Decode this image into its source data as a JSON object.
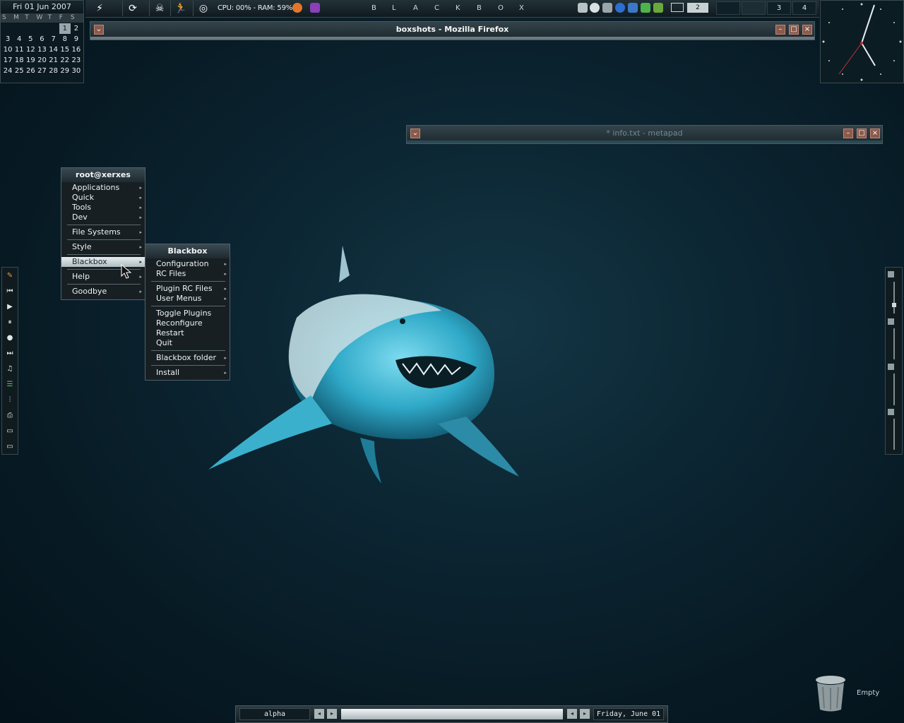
{
  "calendar": {
    "date": "Fri 01 Jun 2007",
    "dow": [
      "S",
      "M",
      "T",
      "W",
      "T",
      "F",
      "S"
    ],
    "weeks": [
      [
        "",
        "",
        "",
        "",
        "",
        "1",
        "2"
      ],
      [
        "3",
        "4",
        "5",
        "6",
        "7",
        "8",
        "9"
      ],
      [
        "10",
        "11",
        "12",
        "13",
        "14",
        "15",
        "16"
      ],
      [
        "17",
        "18",
        "19",
        "20",
        "21",
        "22",
        "23"
      ],
      [
        "24",
        "25",
        "26",
        "27",
        "28",
        "29",
        "30"
      ]
    ]
  },
  "topbar": {
    "cpu_ram": "CPU: 00% - RAM: 59%",
    "workspace_letters": [
      "B",
      "L",
      "A",
      "C",
      "K",
      "B",
      "O",
      "X"
    ],
    "mail_count": "2",
    "pager": [
      "",
      "",
      "3",
      "4"
    ]
  },
  "firefox_window": {
    "title": "boxshots - Mozilla Firefox"
  },
  "metapad_window": {
    "title": "* info.txt - metapad"
  },
  "root_menu": {
    "title": "root@xerxes",
    "items": [
      "Applications",
      "Quick",
      "Tools",
      "Dev",
      "File Systems",
      "Style",
      "Blackbox",
      "Help",
      "Goodbye"
    ]
  },
  "blackbox_menu": {
    "title": "Blackbox",
    "items": [
      "Configuration",
      "RC Files",
      "Plugin RC Files",
      "User Menus",
      "Toggle Plugins",
      "Reconfigure",
      "Restart",
      "Quit",
      "Blackbox folder",
      "Install"
    ]
  },
  "bottombar": {
    "workspace": "alpha",
    "date": "Friday, June 01"
  },
  "trash": {
    "label": "Empty"
  },
  "colors": {
    "desktop_bg": "#0c2633",
    "button_red": "#8b5a4c",
    "menu_bg": "#171f23"
  }
}
